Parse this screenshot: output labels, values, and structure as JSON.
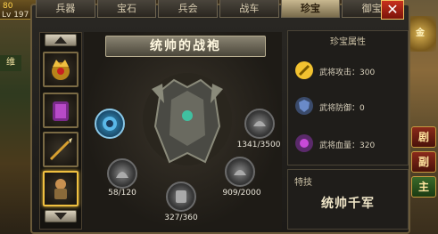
{
  "hud": {
    "badge": "80",
    "level": "Lv 197",
    "left_tag": "维",
    "right_logo": "金",
    "side_buttons": [
      "剧",
      "副",
      "主"
    ]
  },
  "tabs": [
    {
      "label": "兵器",
      "active": false
    },
    {
      "label": "宝石",
      "active": false
    },
    {
      "label": "兵会",
      "active": false
    },
    {
      "label": "战车",
      "active": false
    },
    {
      "label": "珍宝",
      "active": true
    },
    {
      "label": "御宝",
      "active": false
    }
  ],
  "close_label": "✕",
  "center": {
    "banner": "统帅的战袍",
    "gems": [
      {
        "name": "top-left-gem",
        "label": ""
      },
      {
        "name": "right-upper-gem",
        "label": "1341/3500"
      },
      {
        "name": "left-lower-gem",
        "label": "58/120"
      },
      {
        "name": "bottom-gem",
        "label": "327/360"
      },
      {
        "name": "right-lower-gem",
        "label": "909/2000"
      }
    ]
  },
  "attributes": {
    "title": "珍宝属性",
    "rows": [
      {
        "label": "武将攻击：300",
        "icon": "attack-icon",
        "color": "#f2c230"
      },
      {
        "label": "武将防御：0",
        "icon": "defense-icon",
        "color": "#6a8ac8"
      },
      {
        "label": "武将血量：320",
        "icon": "hp-icon",
        "color": "#c84ad8"
      }
    ]
  },
  "special": {
    "title": "特技",
    "name": "统帅千军"
  }
}
